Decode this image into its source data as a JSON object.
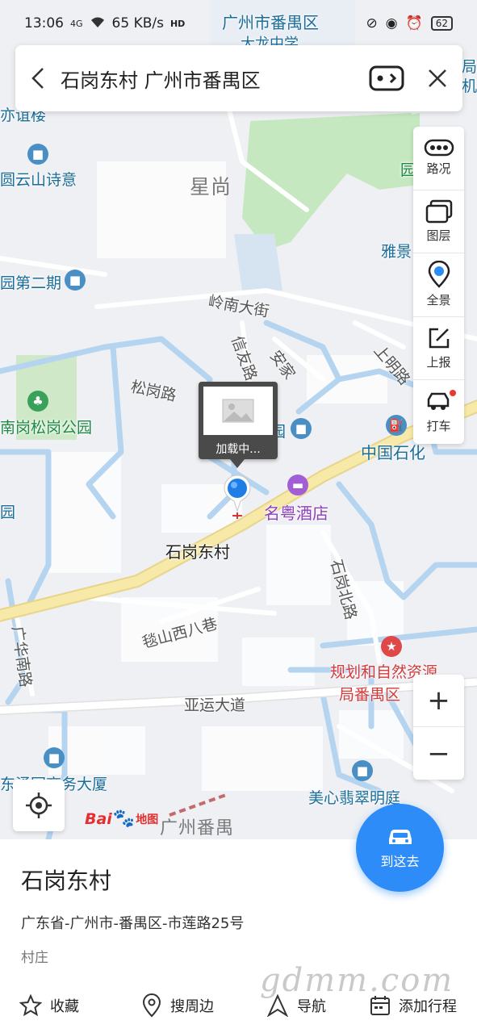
{
  "status_bar": {
    "time": "13:06",
    "signal": "4G",
    "speed": "65 KB/s",
    "hd": "HD",
    "battery": "62"
  },
  "search": {
    "query": "石岗东村 广州市番禺区"
  },
  "tools": [
    {
      "icon": "traffic-icon",
      "label": "路况"
    },
    {
      "icon": "layers-icon",
      "label": "图层"
    },
    {
      "icon": "panorama-icon",
      "label": "全景"
    },
    {
      "icon": "report-icon",
      "label": "上报"
    },
    {
      "icon": "taxi-icon",
      "label": "打车"
    }
  ],
  "zoom": {
    "in": "+",
    "out": "−"
  },
  "map": {
    "labels": {
      "school": "广州市番禺区",
      "school2": "大龙中学",
      "district_star": "星尚",
      "yunshan": "圆云山诗意",
      "yiyuan": "亦谊楼",
      "phase2": "园第二期",
      "lingnan": "岭南大街",
      "xinyou": "信友路",
      "anjia": "安家",
      "shangming": "上明路",
      "songgang": "松岗路",
      "songgang_park": "南岗松岗公园",
      "yuan": "园",
      "sinopec": "中国石化",
      "mingyue": "名粤酒店",
      "place": "石岗东村",
      "shiyan": "石岗北路",
      "tanshan": "毯山西八巷",
      "guanghua": "广华南路",
      "planning1": "规划和自然资源",
      "planning2": "局番禺区",
      "yayun": "亚运大道",
      "meixin": "美心翡翠明庭",
      "tower": "东涌园商务大厦",
      "guangzhou_panyu": "广州番禺",
      "yajing": "雅景",
      "yuan_right": "园",
      "left_edge": "园",
      "top_right_1": "局",
      "top_right_2": "机"
    },
    "logo_bai": "Bai",
    "logo_ditu": "地图",
    "callout_loading": "加载中..."
  },
  "go_button": {
    "label": "到这去"
  },
  "place": {
    "name": "石岗东村",
    "address": "广东省-广州市-番禺区-市莲路25号",
    "type": "村庄"
  },
  "actions": [
    {
      "icon": "star-icon",
      "label": "收藏"
    },
    {
      "icon": "nearby-icon",
      "label": "搜周边"
    },
    {
      "icon": "navigate-icon",
      "label": "导航"
    },
    {
      "icon": "calendar-icon",
      "label": "添加行程"
    }
  ],
  "watermark": "gdmm.com",
  "colors": {
    "accent": "#2d8cf7",
    "main_road": "#f5e49a",
    "waterway": "#b5d4f0",
    "park": "#c5e8c0"
  }
}
